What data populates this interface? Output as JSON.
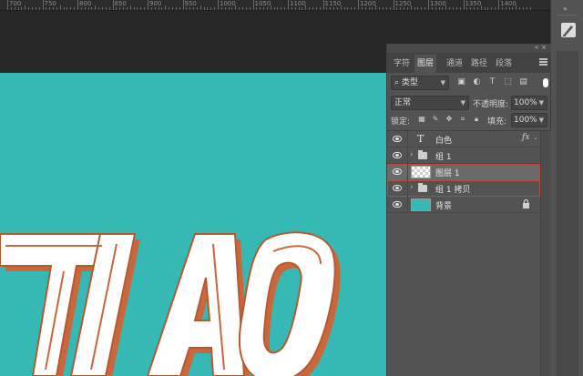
{
  "ruler": {
    "numbers": [
      "700",
      "750",
      "800",
      "850",
      "900",
      "950",
      "1000",
      "1050",
      "1100",
      "1150",
      "1200",
      "1250",
      "1300",
      "1350",
      "1400"
    ]
  },
  "canvas": {
    "art_text": "TIAO",
    "background_color": "#36b9b4"
  },
  "layers_panel": {
    "tabs": [
      {
        "label": "字符",
        "active": false
      },
      {
        "label": "图层",
        "active": true
      },
      {
        "label": "通道",
        "active": false
      },
      {
        "label": "路径",
        "active": false
      },
      {
        "label": "段落",
        "active": false
      }
    ],
    "filter": {
      "kind_label": "类型",
      "icons": [
        "image-filter-icon",
        "adjustment-filter-icon",
        "type-filter-icon",
        "shape-filter-icon",
        "smart-object-filter-icon"
      ]
    },
    "blend_mode": "正常",
    "opacity_label": "不透明度:",
    "opacity_value": "100%",
    "lock_label": "锁定:",
    "fill_label": "填充:",
    "fill_value": "100%",
    "layers": [
      {
        "name": "白色",
        "kind": "text",
        "has_fx": true,
        "fx_label": "fx"
      },
      {
        "name": "组 1",
        "kind": "group"
      },
      {
        "name": "图层 1",
        "kind": "pixel",
        "selected": true
      },
      {
        "name": "组 1 拷贝",
        "kind": "group"
      },
      {
        "name": "背景",
        "kind": "background",
        "locked": true
      }
    ]
  },
  "colors": {
    "canvas_teal": "#36b9b4",
    "letter_fill": "#ffffff",
    "letter_shadow": "#c8683c",
    "highlight_outline": "#b54a3e"
  }
}
